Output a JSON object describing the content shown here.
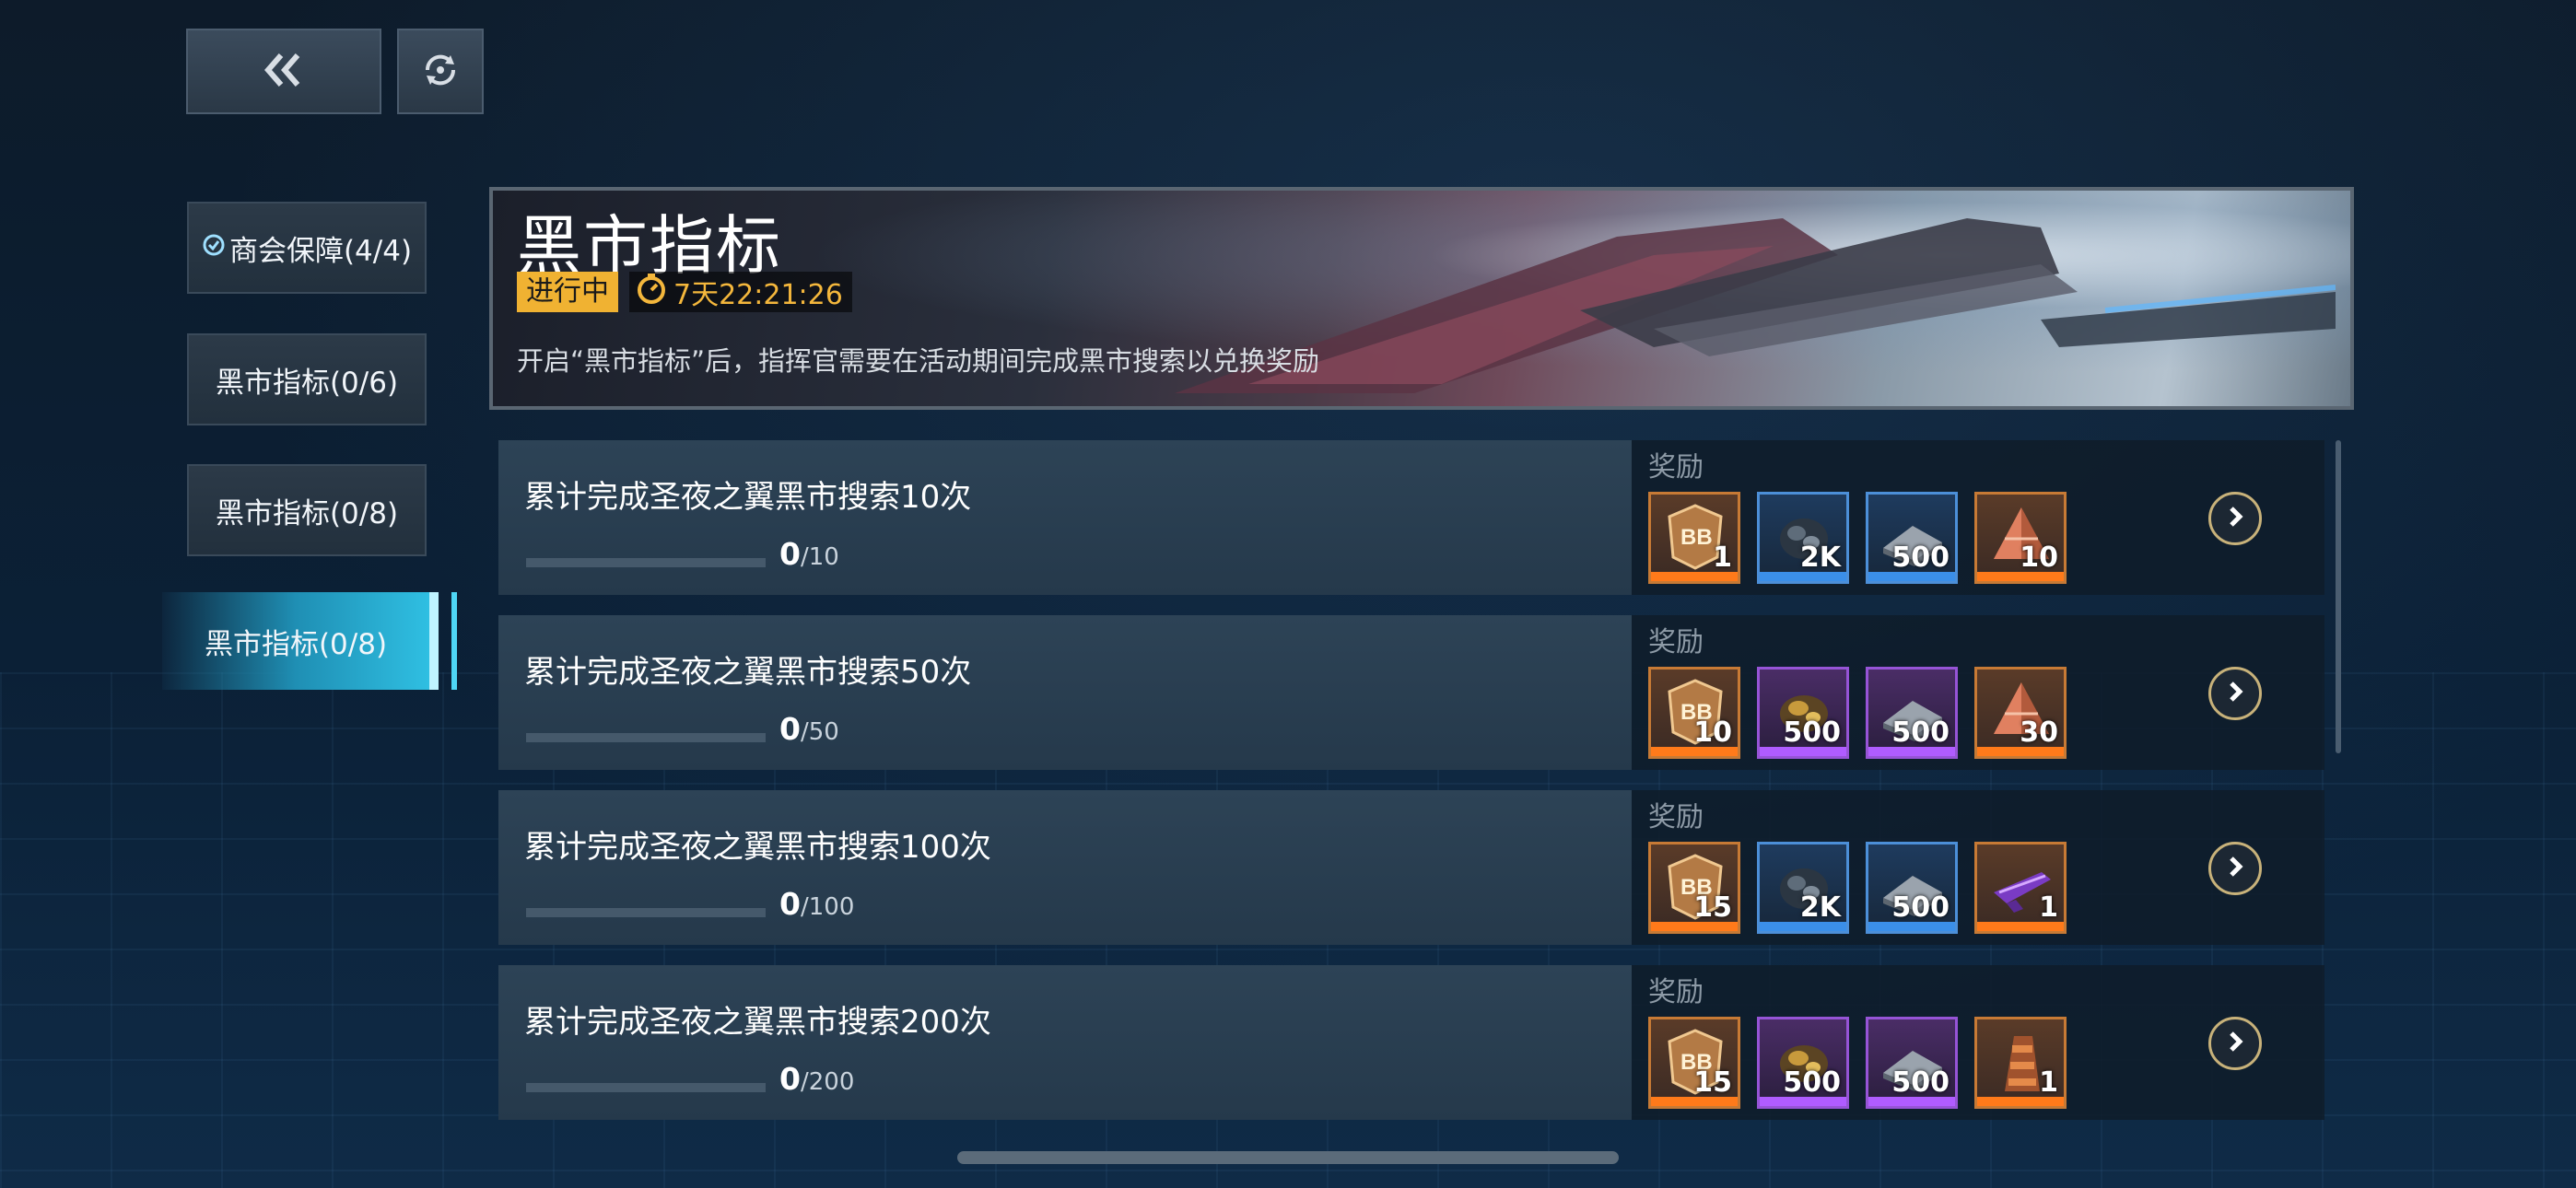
{
  "nav": {
    "back_icon": "double-chevron-left-icon",
    "refresh_icon": "circular-arrows-icon"
  },
  "sidebar": {
    "items": [
      {
        "label": "商会保障(4/4)",
        "completed": true
      },
      {
        "label": "黑市指标(0/6)"
      },
      {
        "label": "黑市指标(0/8)"
      },
      {
        "label": "黑市指标(0/8)",
        "active": true
      }
    ]
  },
  "banner": {
    "title": "黑市指标",
    "status": "进行中",
    "timer": "7天22:21:26",
    "description": "开启“黑市指标”后，指挥官需要在活动期间完成黑市搜索以兑换奖励"
  },
  "reward_label": "奖励",
  "tasks": [
    {
      "title": "累计完成圣夜之翼黑市搜索10次",
      "current": "0",
      "total": "/10",
      "rewards": [
        {
          "icon": "bb-token-icon",
          "rarity": "orange",
          "qty": "1"
        },
        {
          "icon": "ore-rock-icon",
          "rarity": "blue",
          "qty": "2K"
        },
        {
          "icon": "metal-plate-icon",
          "rarity": "blue",
          "qty": "500"
        },
        {
          "icon": "crystal-pyramid-icon",
          "rarity": "orange",
          "qty": "10"
        }
      ]
    },
    {
      "title": "累计完成圣夜之翼黑市搜索50次",
      "current": "0",
      "total": "/50",
      "rewards": [
        {
          "icon": "bb-token-icon",
          "rarity": "orange",
          "qty": "10"
        },
        {
          "icon": "gold-ore-icon",
          "rarity": "purple",
          "qty": "500"
        },
        {
          "icon": "metal-plate-icon",
          "rarity": "purple",
          "qty": "500"
        },
        {
          "icon": "crystal-pyramid-icon",
          "rarity": "orange",
          "qty": "30"
        }
      ]
    },
    {
      "title": "累计完成圣夜之翼黑市搜索100次",
      "current": "0",
      "total": "/100",
      "rewards": [
        {
          "icon": "bb-token-icon",
          "rarity": "orange",
          "qty": "15"
        },
        {
          "icon": "ore-rock-icon",
          "rarity": "blue",
          "qty": "2K"
        },
        {
          "icon": "metal-plate-icon",
          "rarity": "blue",
          "qty": "500"
        },
        {
          "icon": "purple-weapon-icon",
          "rarity": "orange",
          "qty": "1"
        }
      ]
    },
    {
      "title": "累计完成圣夜之翼黑市搜索200次",
      "current": "0",
      "total": "/200",
      "rewards": [
        {
          "icon": "bb-token-icon",
          "rarity": "orange",
          "qty": "15"
        },
        {
          "icon": "gold-ore-icon",
          "rarity": "purple",
          "qty": "500"
        },
        {
          "icon": "metal-plate-icon",
          "rarity": "purple",
          "qty": "500"
        },
        {
          "icon": "ship-part-icon",
          "rarity": "orange",
          "qty": "1"
        }
      ]
    }
  ]
}
